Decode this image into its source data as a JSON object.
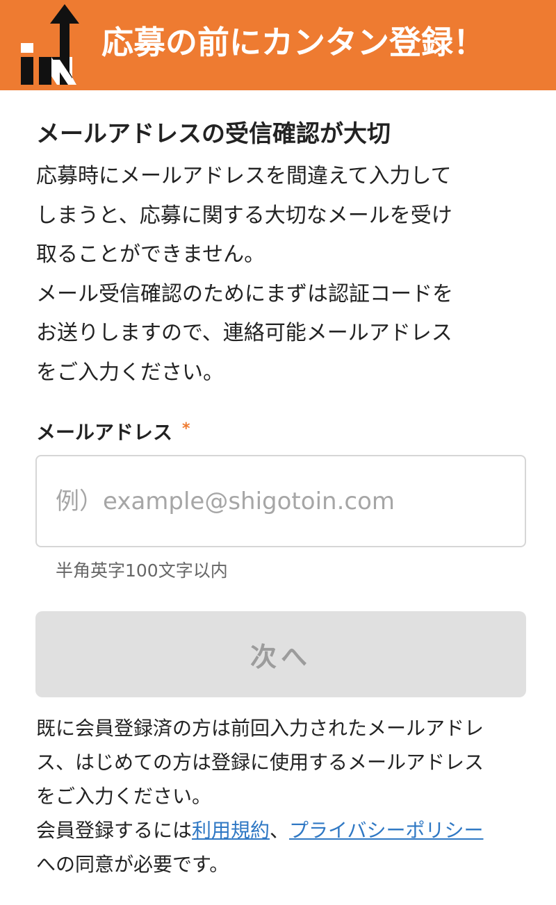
{
  "header": {
    "title": "応募の前にカンタン登録！",
    "logo_icon": "in-arrow-logo",
    "background_color": "#ee7b31"
  },
  "intro": {
    "title": "メールアドレスの受信確認が大切",
    "paragraph1_line1": "応募時にメールアドレスを間違えて入力して",
    "paragraph1_line2": "しまうと、応募に関する大切なメールを受け",
    "paragraph1_line3": "取ることができません。",
    "paragraph2_line1": "メール受信確認のためにまずは認証コードを",
    "paragraph2_line2": "お送りしますので、連絡可能メールアドレス",
    "paragraph2_line3": "をご入力ください。"
  },
  "form": {
    "email_label": "メールアドレス",
    "required_mark": "*",
    "email_value": "",
    "email_placeholder": "例）example@shigotoin.com",
    "email_hint": "半角英字100文字以内",
    "next_button_label": "次へ",
    "next_button_disabled": true
  },
  "notes": {
    "line1": "既に会員登録済の方は前回入力されたメールアドレ",
    "line2": "ス、はじめての方は登録に使用するメールアドレス",
    "line3": "をご入力ください。",
    "agreement_prefix": "会員登録するには",
    "terms_link": "利用規約",
    "separator": "、",
    "privacy_link": "プライバシーポリシー",
    "agreement_suffix": "への同意が必要です。"
  },
  "colors": {
    "accent": "#ee7b31",
    "link": "#2f78c4",
    "button_disabled_bg": "#e0e0e0",
    "button_disabled_text": "#9c9c9c"
  }
}
